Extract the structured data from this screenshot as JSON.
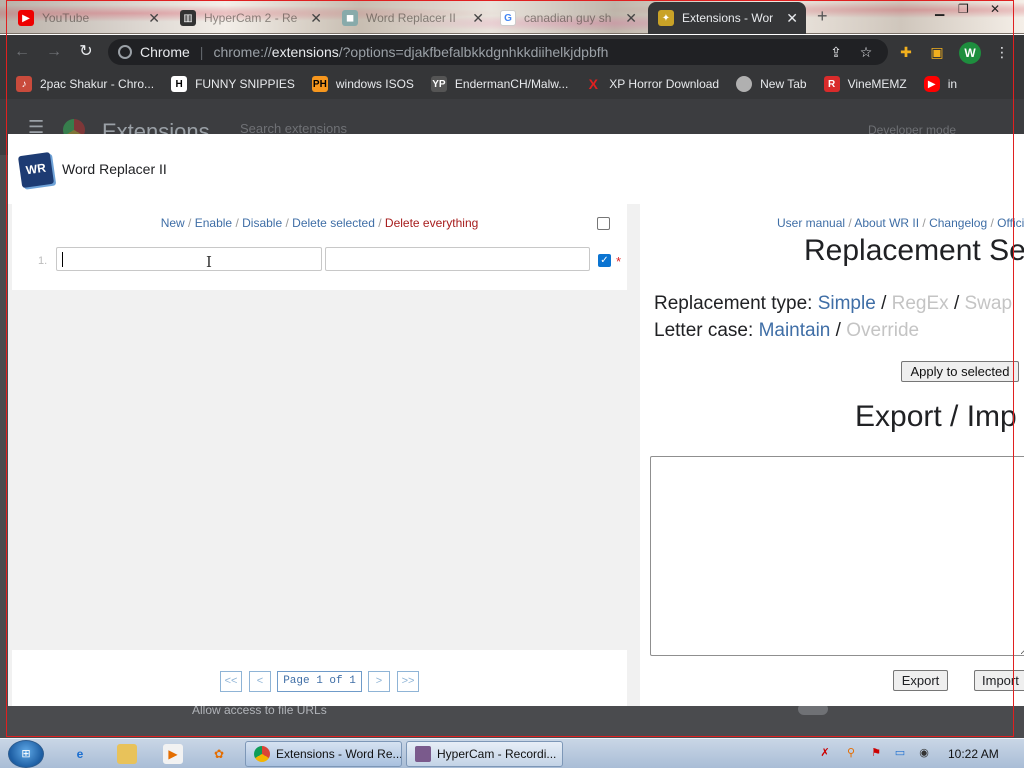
{
  "browser": {
    "tabs": [
      {
        "label": "YouTube",
        "active": false
      },
      {
        "label": "HyperCam 2 - Re",
        "active": false
      },
      {
        "label": "Word Replacer II",
        "active": false
      },
      {
        "label": "canadian guy sh",
        "active": false
      },
      {
        "label": "Extensions - Wor",
        "active": true
      }
    ],
    "omnibox": {
      "site_label": "Chrome",
      "url_scheme": "chrome://",
      "url_host": "extensions",
      "url_rest": "/?options=djakfbefalbkkdgnhkkdiihelkjdpbfh"
    },
    "profile_initial": "W",
    "bookmarks": [
      {
        "label": "2pac Shakur - Chro...",
        "icon": "music-icon",
        "color": "#c94b3c"
      },
      {
        "label": "FUNNY SNIPPIES",
        "icon": "h-logo-icon",
        "color": "#ffffff"
      },
      {
        "label": "windows ISOS",
        "icon": "ph-logo-icon",
        "color": "#f7971e"
      },
      {
        "label": "EndermanCH/Malw...",
        "icon": "yp-logo-icon",
        "color": "#555555"
      },
      {
        "label": "XP Horror Download",
        "icon": "x-logo-icon",
        "color": "#e02020"
      },
      {
        "label": "New Tab",
        "icon": "globe-icon",
        "color": "#b0b0b0"
      },
      {
        "label": "VineMEMZ",
        "icon": "r-logo-icon",
        "color": "#d92b2b"
      },
      {
        "label": "in",
        "icon": "youtube-icon",
        "color": "#ff0000"
      }
    ]
  },
  "extensions_page": {
    "title": "Extensions",
    "search_placeholder": "Search extensions",
    "developer_mode_label": "Developer mode",
    "file_urls_label": "Allow access to file URLs"
  },
  "dialog": {
    "title": "Word Replacer II",
    "logo_text": "WR",
    "list_actions": {
      "new": "New",
      "enable": "Enable",
      "disable": "Disable",
      "delete_selected": "Delete selected",
      "delete_everything": "Delete everything",
      "separator": " / "
    },
    "rows": [
      {
        "number": "1.",
        "find": "",
        "replace": "",
        "enabled": true,
        "star": "*"
      }
    ],
    "pager": {
      "first": "<<",
      "prev": "<",
      "page_label": "Page 1 of 1",
      "next": ">",
      "last": ">>"
    },
    "links": {
      "user_manual": "User manual",
      "about": "About WR II",
      "changelog": "Changelog",
      "official": "Offici"
    },
    "settings_heading": "Replacement Se",
    "replacement_type": {
      "label": "Replacement type:",
      "simple": "Simple",
      "regex": "RegEx",
      "swap": "Swap"
    },
    "letter_case": {
      "label": "Letter case:",
      "maintain": "Maintain",
      "override": "Override"
    },
    "apply_button": "Apply to selected",
    "export_heading": "Export / Imp",
    "export_text": "",
    "export_button": "Export",
    "import_button": "Import"
  },
  "taskbar": {
    "start_label": "⊞",
    "tasks": [
      {
        "label": "Extensions - Word Re...",
        "active": true
      },
      {
        "label": "HyperCam - Recordi...",
        "active": false
      }
    ],
    "clock": "10:22 AM"
  }
}
